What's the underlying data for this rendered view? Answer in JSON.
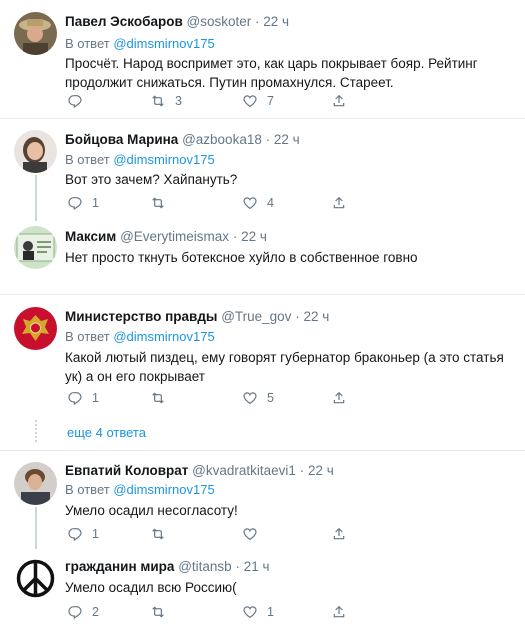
{
  "reply_prefix": "В ответ",
  "tweets": [
    {
      "name": "Павел Эскобаров",
      "handle": "@soskoter",
      "time": "22 ч",
      "reply_to": "@dimsmirnov175",
      "text": "Просчёт. Народ воспримет это, как царь покрывает бояр. Рейтинг продолжит снижаться. Путин промахнулся. Стареет.",
      "replies": "",
      "retweets": "3",
      "likes": "7"
    },
    {
      "name": "Бойцова Марина",
      "handle": "@azbooka18",
      "time": "22 ч",
      "reply_to": "@dimsmirnov175",
      "text": "Вот это зачем? Хайпануть?",
      "replies": "1",
      "retweets": "",
      "likes": "4"
    },
    {
      "name": "Максим",
      "handle": "@Everytimeismax",
      "time": "22 ч",
      "reply_to": "",
      "text": "Нет просто ткнуть ботексное хуйло в собственное говно",
      "replies": "",
      "retweets": "",
      "likes": ""
    },
    {
      "name": "Министерство правды",
      "handle": "@True_gov",
      "time": "22 ч",
      "reply_to": "@dimsmirnov175",
      "text": "Какой лютый пиздец, ему говорят губернатор браконьер (а это статья ук) а он его покрывает",
      "replies": "1",
      "retweets": "",
      "likes": "5"
    },
    {
      "name": "Евпатий Коловрат",
      "handle": "@kvadratkitaevi1",
      "time": "22 ч",
      "reply_to": "@dimsmirnov175",
      "text": "Умело осадил несогласоту!",
      "replies": "1",
      "retweets": "",
      "likes": ""
    },
    {
      "name": "гражданин мира",
      "handle": "@titansb",
      "time": "21 ч",
      "reply_to": "",
      "text": "Умело осадил всю Россию(",
      "replies": "2",
      "retweets": "",
      "likes": "1"
    }
  ],
  "more_replies": "еще 4 ответа",
  "colors": {
    "accent": "#1b95e0",
    "secondary_text": "#657786",
    "divider": "#e6ecf0"
  }
}
